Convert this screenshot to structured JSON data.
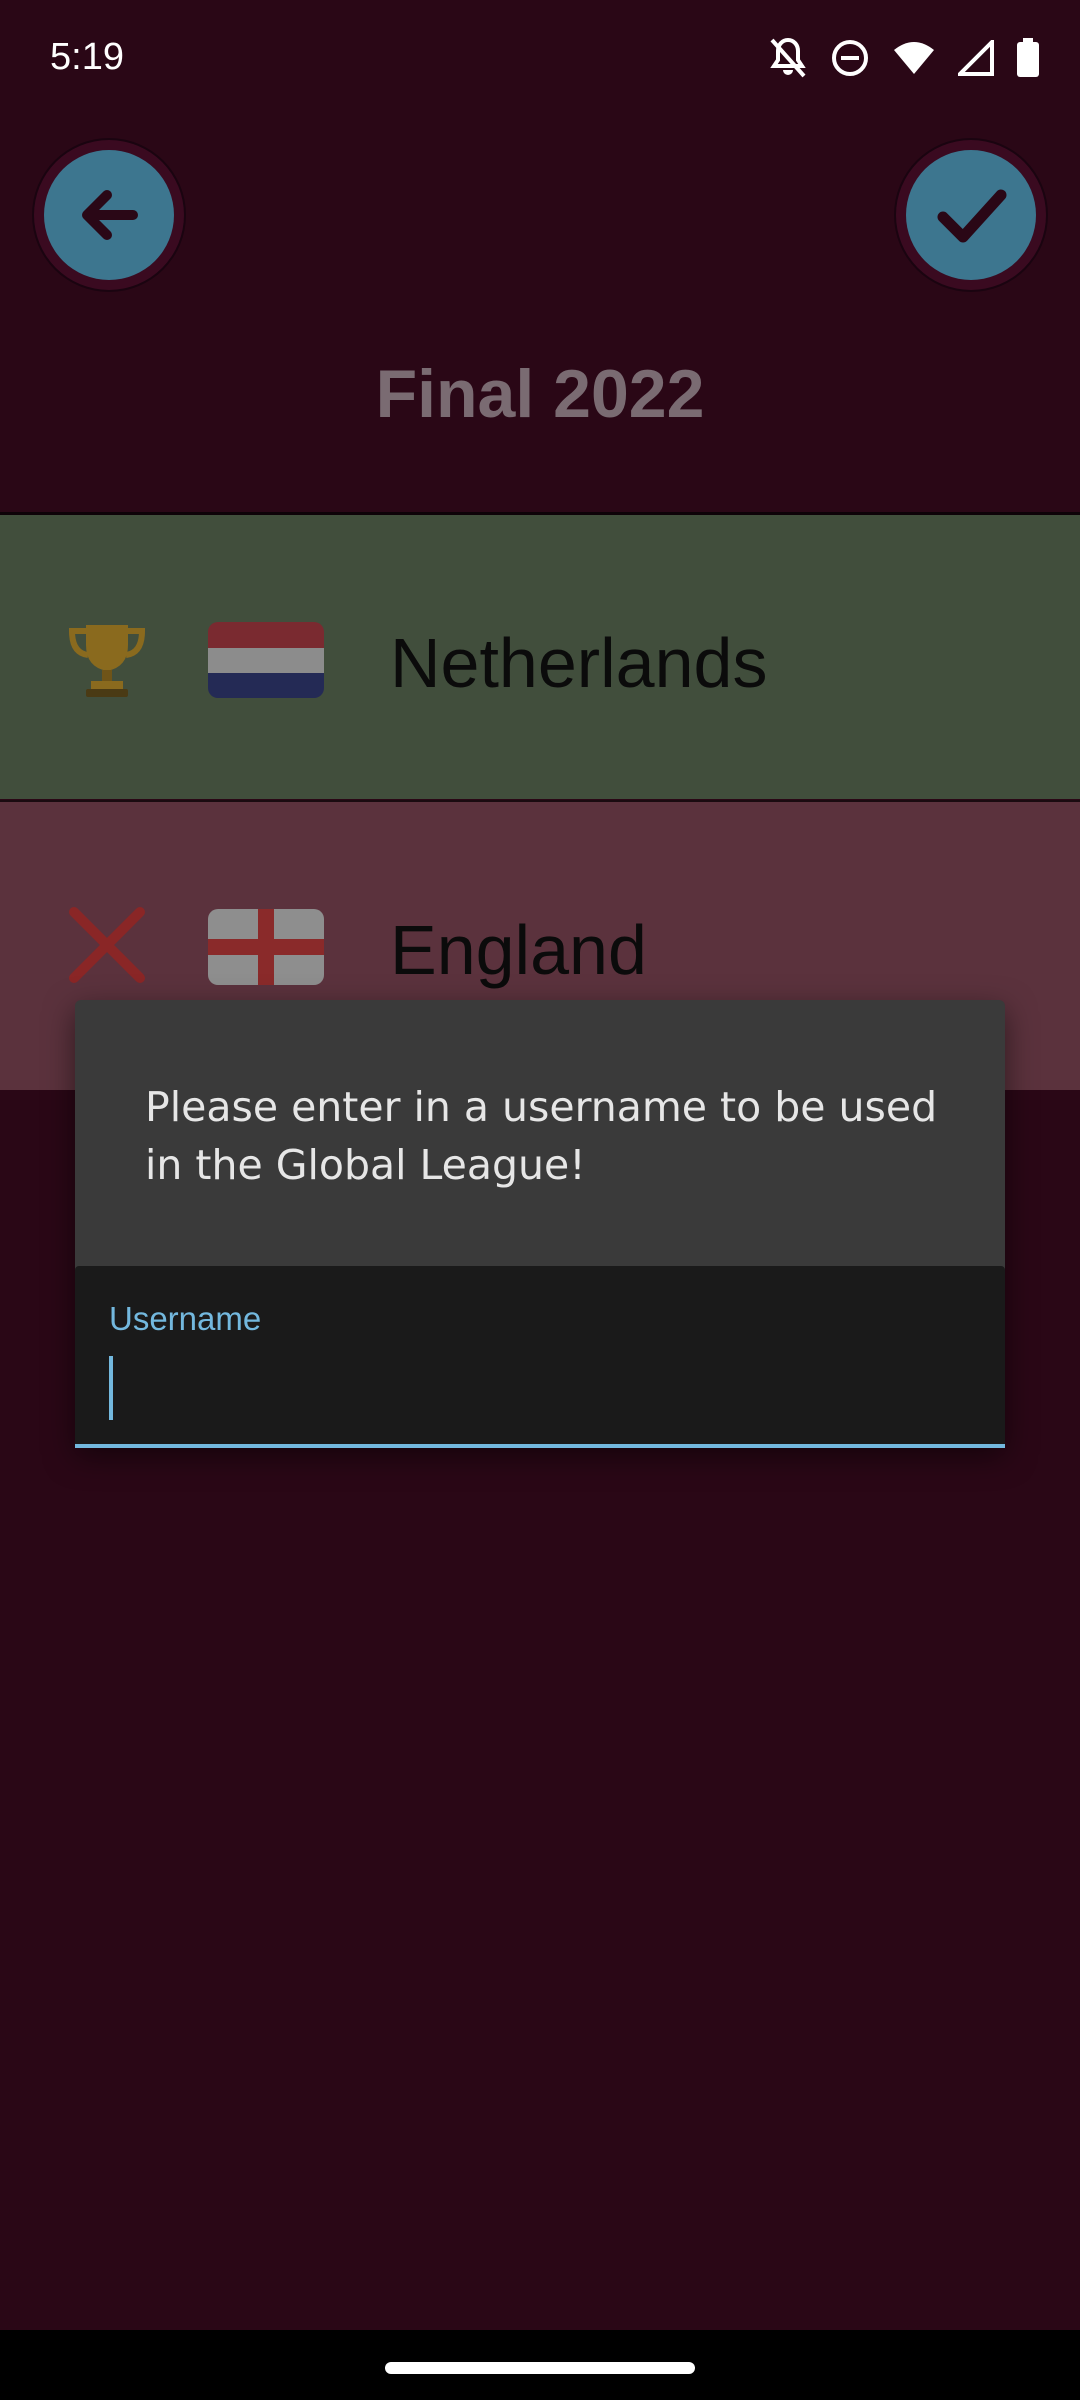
{
  "status_bar": {
    "time": "5:19"
  },
  "header": {
    "title": "Final 2022"
  },
  "teams": [
    {
      "name": "Netherlands",
      "result_icon": "trophy-icon",
      "flag": "netherlands-flag"
    },
    {
      "name": "England",
      "result_icon": "cross-icon",
      "flag": "england-flag"
    }
  ],
  "dialog": {
    "message": "Please enter in a username to be used in the Global League!",
    "input_label": "Username",
    "input_value": ""
  },
  "colors": {
    "background": "#2a0716",
    "accent": "#73b8de",
    "winner_row": "#414e3c",
    "loser_row": "#5b323d",
    "button": "#3d768f"
  }
}
